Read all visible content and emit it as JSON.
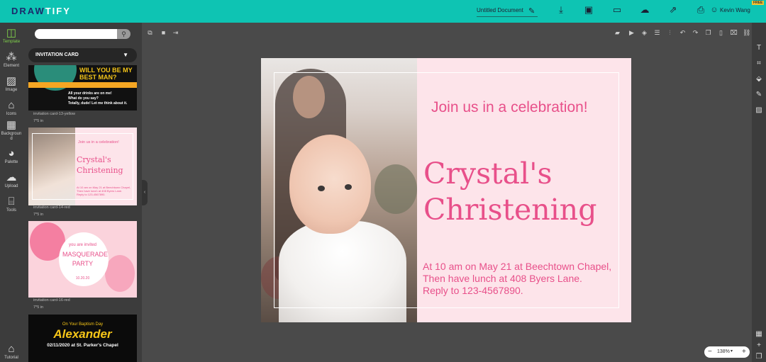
{
  "app": {
    "logo_main": "DRAW",
    "logo_accent": "TIFY",
    "doc_title": "Untitled Document",
    "user_name": "Kevin Wang",
    "free_badge": "FREE"
  },
  "toolbar": {
    "icons": [
      "download-icon",
      "save-icon",
      "present-icon",
      "cloud-icon",
      "share-icon",
      "print-icon",
      "user-icon"
    ]
  },
  "left_rail": {
    "items": [
      {
        "label": "Template",
        "icon": "template-icon"
      },
      {
        "label": "Element",
        "icon": "element-icon"
      },
      {
        "label": "Image",
        "icon": "image-icon"
      },
      {
        "label": "Icons",
        "icon": "icons-icon"
      },
      {
        "label": "Background",
        "icon": "background-icon"
      },
      {
        "label": "Palette",
        "icon": "palette-icon"
      },
      {
        "label": "Upload",
        "icon": "upload-icon"
      },
      {
        "label": "Tools",
        "icon": "tools-icon"
      },
      {
        "label": "Tutorial",
        "icon": "tutorial-icon"
      }
    ]
  },
  "panel": {
    "category": "INVITATION CARD",
    "templates": [
      {
        "name": "invitation card-13-yellow",
        "size": "7*5 in",
        "heading": "WILL YOU BE MY BEST MAN?",
        "body": [
          "All your drinks are on me!",
          "What do you say?",
          "Totally, dude! Let me think about it."
        ]
      },
      {
        "name": "invitation card-14-red",
        "size": "7*5 in",
        "heading": "Join us in a celebration!",
        "title": "Crystal's Christening",
        "body": [
          "At 10 am on May 21 at Beechtown Chapel,",
          "Then have lunch at 408 Byers Lane.",
          "Reply to 123-4567890."
        ]
      },
      {
        "name": "invitation card-16-red",
        "size": "7*5 in",
        "heading": "you are invited",
        "title": "MASQUERADE PARTY",
        "date": "10.20.20"
      },
      {
        "heading": "On Your Baptism Day",
        "title": "Alexander",
        "body": "02/11/2020 at St. Parker's Chapel"
      }
    ]
  },
  "canvas": {
    "heading": "Join us in a celebration!",
    "title_line1": "Crystal's",
    "title_line2": "Christening",
    "body_line1": "At 10 am on May 21 at Beechtown Chapel,",
    "body_line2": "Then have lunch at 408 Byers Lane.",
    "body_line3": "Reply to 123-4567890."
  },
  "zoom": {
    "value": "138%",
    "minus": "−",
    "plus": "+"
  },
  "colors": {
    "topbar": "#0ec4b3",
    "accent_pink": "#e8508a",
    "card_bg": "#fde4ea"
  }
}
